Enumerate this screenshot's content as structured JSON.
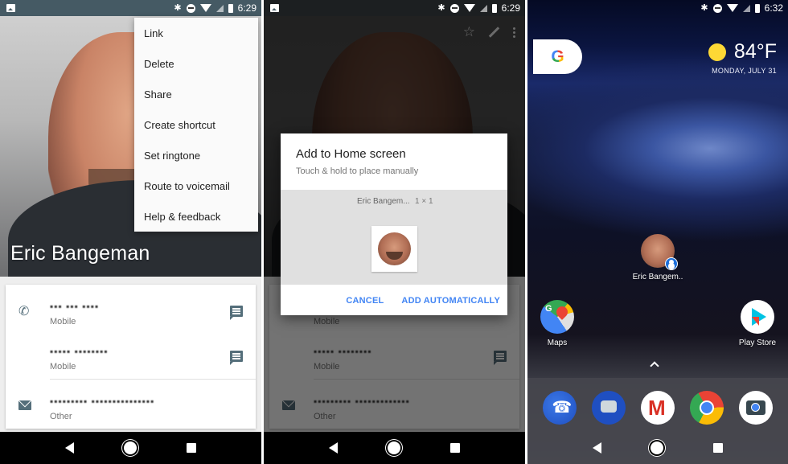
{
  "colors": {
    "statusbar_contact": "#455a64",
    "accent_blue": "#4285f4",
    "icon_grey": "#546e7a"
  },
  "screen1": {
    "status": {
      "time": "6:29",
      "icons": [
        "image-notification-icon",
        "bluetooth-icon",
        "do-not-disturb-icon",
        "wifi-icon",
        "cell-signal-icon",
        "battery-icon"
      ]
    },
    "contact_name": "Eric Bangeman",
    "overflow_menu": [
      {
        "label": "Link"
      },
      {
        "label": "Delete"
      },
      {
        "label": "Share"
      },
      {
        "label": "Create shortcut"
      },
      {
        "label": "Set ringtone"
      },
      {
        "label": "Route to voicemail"
      },
      {
        "label": "Help & feedback"
      }
    ],
    "details": [
      {
        "icon": "phone-icon",
        "value": "▪▪▪ ▪▪▪ ▪▪▪▪",
        "label": "Mobile",
        "action": "message-icon"
      },
      {
        "icon": "",
        "value": "▪▪▪▪▪ ▪▪▪▪▪▪▪▪",
        "label": "Mobile",
        "action": "message-icon"
      },
      {
        "icon": "email-icon",
        "value": "▪▪▪▪▪▪▪▪▪ ▪▪▪▪▪▪▪▪▪▪▪▪▪▪▪",
        "label": "Other",
        "action": ""
      }
    ]
  },
  "screen2": {
    "status": {
      "time": "6:29"
    },
    "toolbar": [
      "star-icon",
      "edit-icon",
      "more-vert-icon"
    ],
    "dialog": {
      "title": "Add to Home screen",
      "subtitle": "Touch & hold to place manually",
      "widget_name": "Eric Bangem...",
      "widget_size": "1 × 1",
      "cancel_label": "CANCEL",
      "confirm_label": "ADD AUTOMATICALLY"
    },
    "details": [
      {
        "value": "▪▪▪▪▪ ▪▪▪▪▪▪▪▪",
        "label": "Mobile"
      },
      {
        "value": "▪▪▪▪▪▪▪▪▪ ▪▪▪▪▪▪▪▪▪▪▪▪▪",
        "label": "Other"
      }
    ],
    "partial_mobile_label": "Mobile"
  },
  "screen3": {
    "status": {
      "time": "6:32"
    },
    "weather": {
      "temperature": "84°F",
      "date": "MONDAY, JULY 31"
    },
    "google_letter": "G",
    "shortcut": {
      "label": "Eric Bangem.."
    },
    "apps": [
      {
        "label": "Maps"
      },
      {
        "label": "Play Store"
      }
    ],
    "dock": [
      "phone-app-icon",
      "messages-app-icon",
      "gmail-app-icon",
      "chrome-app-icon",
      "camera-app-icon"
    ]
  }
}
